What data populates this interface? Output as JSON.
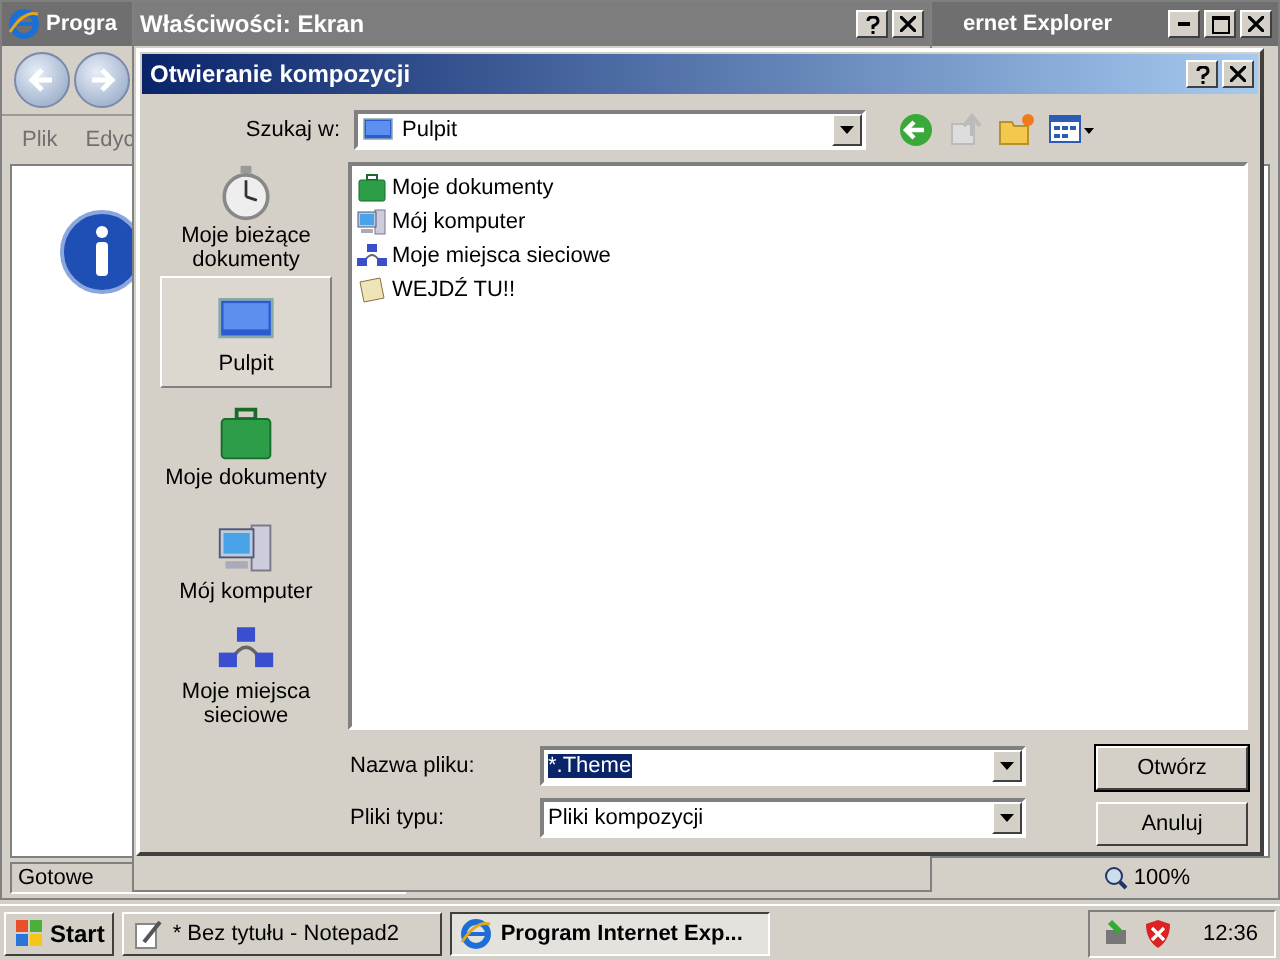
{
  "background_window": {
    "title": "Progra",
    "title_tail": "ernet Explorer",
    "menu": [
      "Plik",
      "Edyc"
    ],
    "status": "Gotowe",
    "zoom": "100%"
  },
  "properties_window": {
    "title": "Właściwości: Ekran"
  },
  "dialog": {
    "title": "Otwieranie kompozycji",
    "look_in_label": "Szukaj w:",
    "look_in_value": "Pulpit",
    "places": [
      {
        "label": "Moje bieżące dokumenty",
        "kind": "recent",
        "selected": false
      },
      {
        "label": "Pulpit",
        "kind": "desktop",
        "selected": true
      },
      {
        "label": "Moje dokumenty",
        "kind": "documents",
        "selected": false
      },
      {
        "label": "Mój komputer",
        "kind": "computer",
        "selected": false
      },
      {
        "label": "Moje miejsca sieciowe",
        "kind": "network",
        "selected": false
      }
    ],
    "files": [
      {
        "name": "Moje dokumenty",
        "kind": "documents"
      },
      {
        "name": "Mój komputer",
        "kind": "computer"
      },
      {
        "name": "Moje miejsca sieciowe",
        "kind": "network"
      },
      {
        "name": "WEJDŹ TU!!",
        "kind": "shortcut"
      }
    ],
    "filename_label": "Nazwa pliku:",
    "filename_value": "*.Theme",
    "filetype_label": "Pliki typu:",
    "filetype_value": "Pliki kompozycji",
    "buttons": [
      "Otwórz",
      "Anuluj"
    ]
  },
  "taskbar": {
    "start": "Start",
    "tasks": [
      {
        "label": "* Bez tytułu - Notepad2",
        "kind": "notepad",
        "selected": false
      },
      {
        "label": "Program Internet Exp...",
        "kind": "browser",
        "selected": true
      }
    ],
    "clock": "12:36"
  }
}
